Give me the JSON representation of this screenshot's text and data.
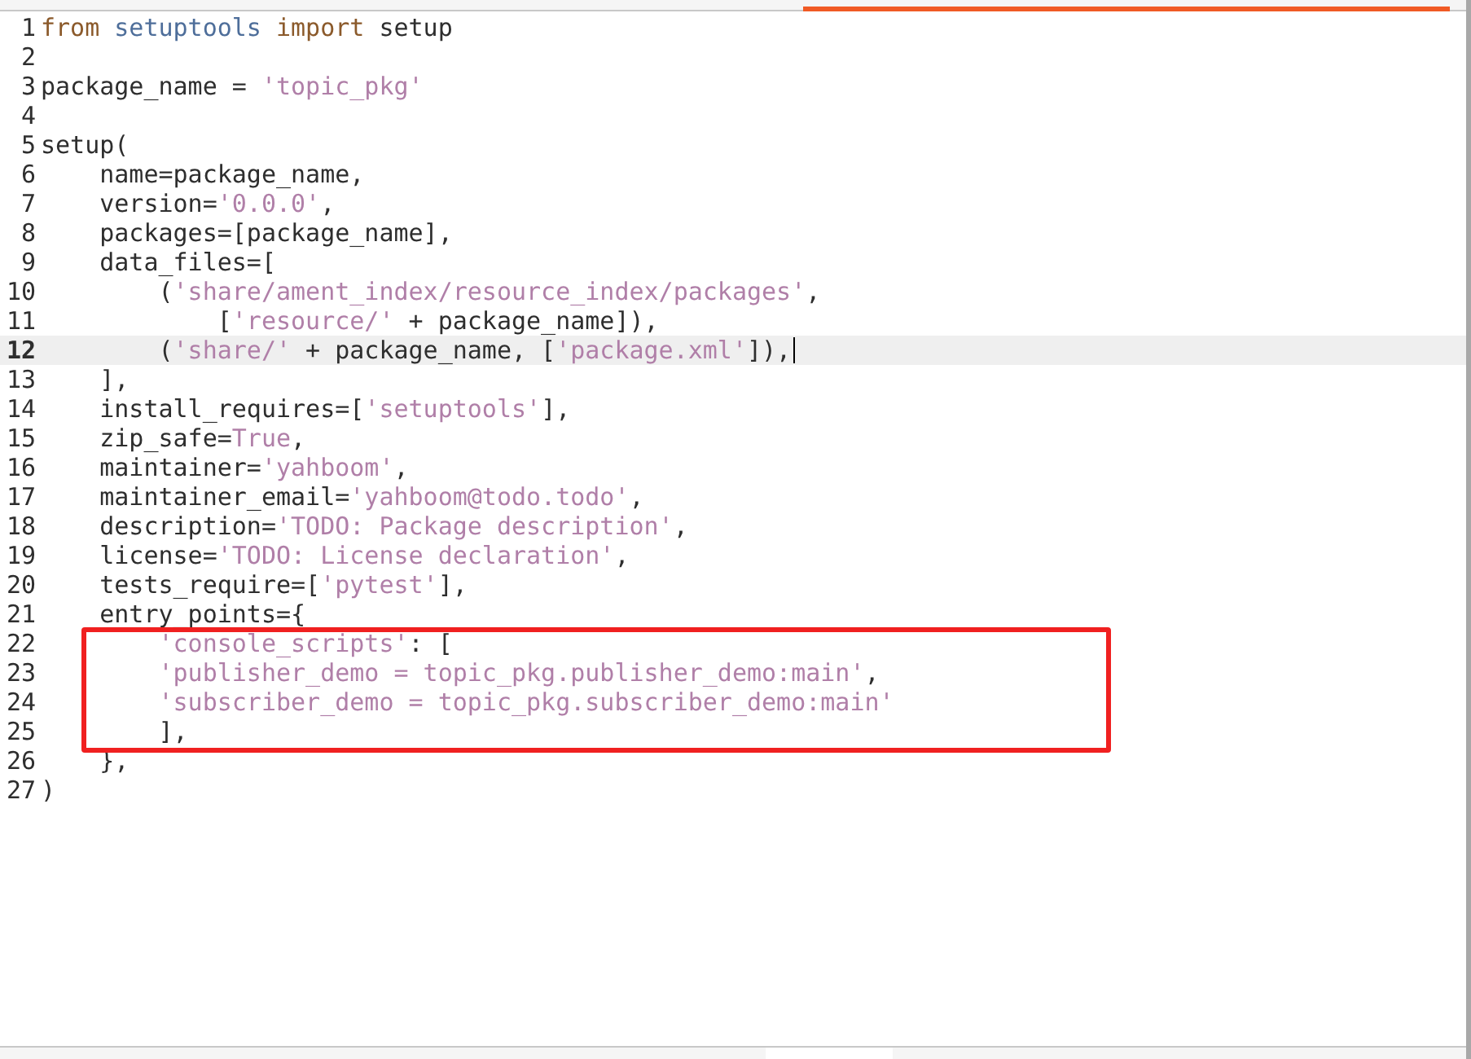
{
  "editor": {
    "lines": [
      {
        "number": "1",
        "current": false,
        "tokens": [
          {
            "kind": "keyword",
            "text": "from "
          },
          {
            "kind": "module",
            "text": "setuptools "
          },
          {
            "kind": "keyword",
            "text": "import"
          },
          {
            "kind": "plain",
            "text": " setup"
          }
        ]
      },
      {
        "number": "2",
        "current": false
      },
      {
        "number": "3",
        "current": false,
        "tokens": [
          {
            "kind": "plain",
            "text": "package_name = "
          },
          {
            "kind": "string",
            "text": "'topic_pkg'"
          }
        ]
      },
      {
        "number": "4",
        "current": false
      },
      {
        "number": "5",
        "current": false,
        "tokens": [
          {
            "kind": "plain",
            "text": "setup("
          }
        ]
      },
      {
        "number": "6",
        "current": false,
        "tokens": [
          {
            "kind": "plain",
            "text": "    name=package_name,"
          }
        ]
      },
      {
        "number": "7",
        "current": false,
        "tokens": [
          {
            "kind": "plain",
            "text": "    version="
          },
          {
            "kind": "string",
            "text": "'0.0.0'"
          },
          {
            "kind": "plain",
            "text": ","
          }
        ]
      },
      {
        "number": "8",
        "current": false,
        "tokens": [
          {
            "kind": "plain",
            "text": "    packages=[package_name],"
          }
        ]
      },
      {
        "number": "9",
        "current": false,
        "tokens": [
          {
            "kind": "plain",
            "text": "    data_files=["
          }
        ]
      },
      {
        "number": "10",
        "current": false,
        "tokens": [
          {
            "kind": "plain",
            "text": "        ("
          },
          {
            "kind": "string",
            "text": "'share/ament_index/resource_index/packages'"
          },
          {
            "kind": "plain",
            "text": ","
          }
        ]
      },
      {
        "number": "11",
        "current": false,
        "tokens": [
          {
            "kind": "plain",
            "text": "            ["
          },
          {
            "kind": "string",
            "text": "'resource/'"
          },
          {
            "kind": "plain",
            "text": " + package_name]),"
          }
        ]
      },
      {
        "number": "12",
        "current": true,
        "tokens": [
          {
            "kind": "plain",
            "text": "        ("
          },
          {
            "kind": "string",
            "text": "'share/'"
          },
          {
            "kind": "plain",
            "text": " + package_name, ["
          },
          {
            "kind": "string",
            "text": "'package.xml'"
          },
          {
            "kind": "plain",
            "text": "]),"
          }
        ]
      },
      {
        "number": "13",
        "current": false,
        "tokens": [
          {
            "kind": "plain",
            "text": "    ],"
          }
        ]
      },
      {
        "number": "14",
        "current": false,
        "tokens": [
          {
            "kind": "plain",
            "text": "    install_requires=["
          },
          {
            "kind": "string",
            "text": "'setuptools'"
          },
          {
            "kind": "plain",
            "text": "],"
          }
        ]
      },
      {
        "number": "15",
        "current": false,
        "tokens": [
          {
            "kind": "plain",
            "text": "    zip_safe="
          },
          {
            "kind": "string",
            "text": "True"
          },
          {
            "kind": "plain",
            "text": ","
          }
        ]
      },
      {
        "number": "16",
        "current": false,
        "tokens": [
          {
            "kind": "plain",
            "text": "    maintainer="
          },
          {
            "kind": "string",
            "text": "'yahboom'"
          },
          {
            "kind": "plain",
            "text": ","
          }
        ]
      },
      {
        "number": "17",
        "current": false,
        "tokens": [
          {
            "kind": "plain",
            "text": "    maintainer_email="
          },
          {
            "kind": "string",
            "text": "'yahboom@todo.todo'"
          },
          {
            "kind": "plain",
            "text": ","
          }
        ]
      },
      {
        "number": "18",
        "current": false,
        "tokens": [
          {
            "kind": "plain",
            "text": "    description="
          },
          {
            "kind": "string",
            "text": "'TODO: Package description'"
          },
          {
            "kind": "plain",
            "text": ","
          }
        ]
      },
      {
        "number": "19",
        "current": false,
        "tokens": [
          {
            "kind": "plain",
            "text": "    license="
          },
          {
            "kind": "string",
            "text": "'TODO: License declaration'"
          },
          {
            "kind": "plain",
            "text": ","
          }
        ]
      },
      {
        "number": "20",
        "current": false,
        "tokens": [
          {
            "kind": "plain",
            "text": "    tests_require=["
          },
          {
            "kind": "string",
            "text": "'pytest'"
          },
          {
            "kind": "plain",
            "text": "],"
          }
        ]
      },
      {
        "number": "21",
        "current": false,
        "tokens": [
          {
            "kind": "plain",
            "text": "    entry_points={"
          }
        ]
      },
      {
        "number": "22",
        "current": false,
        "tokens": [
          {
            "kind": "string",
            "text": "        'console_scripts'"
          },
          {
            "kind": "plain",
            "text": ": ["
          }
        ]
      },
      {
        "number": "23",
        "current": false,
        "tokens": [
          {
            "kind": "string",
            "text": "        'publisher_demo = topic_pkg.publisher_demo:main'"
          },
          {
            "kind": "plain",
            "text": ","
          }
        ]
      },
      {
        "number": "24",
        "current": false,
        "tokens": [
          {
            "kind": "string",
            "text": "        'subscriber_demo = topic_pkg.subscriber_demo:main'"
          }
        ]
      },
      {
        "number": "25",
        "current": false,
        "tokens": [
          {
            "kind": "plain",
            "text": "        ],"
          }
        ]
      },
      {
        "number": "26",
        "current": false,
        "tokens": [
          {
            "kind": "plain",
            "text": "    },"
          }
        ]
      },
      {
        "number": "27",
        "current": false,
        "tokens": [
          {
            "kind": "plain",
            "text": ")"
          }
        ]
      }
    ]
  }
}
